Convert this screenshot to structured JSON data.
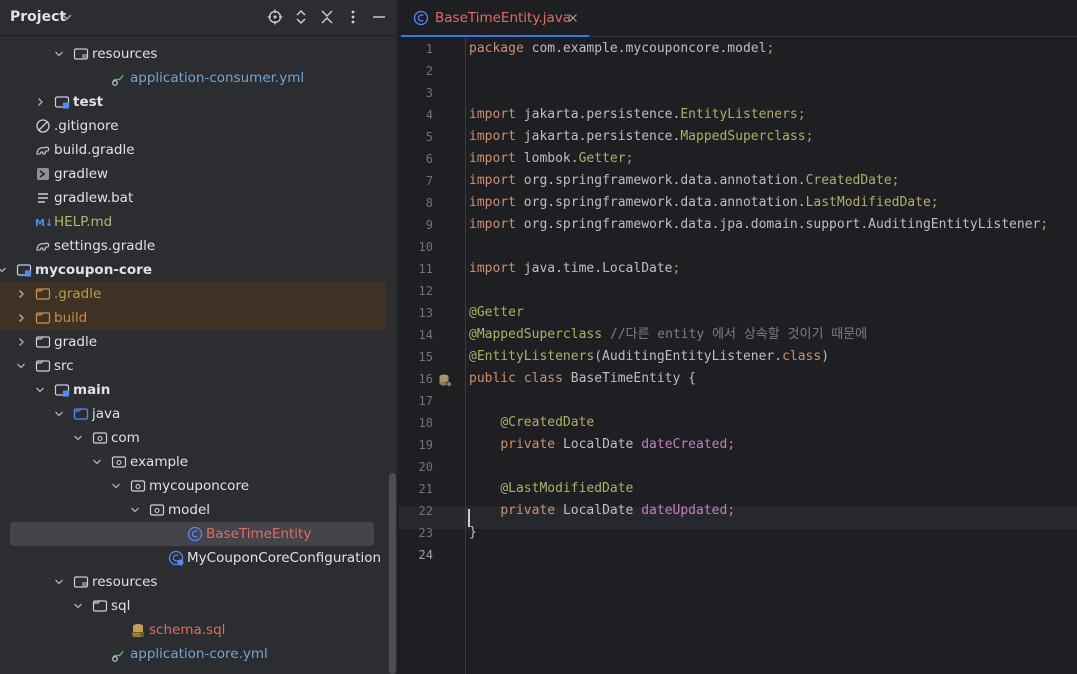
{
  "project_panel": {
    "title": "Project",
    "tree": [
      {
        "label": "resources",
        "depth": 5,
        "icon": "resources-folder-icon",
        "chevron": "down"
      },
      {
        "label": "application-consumer.yml",
        "depth": 7,
        "icon": "yaml-file-icon",
        "style": "yaml"
      },
      {
        "label": "test",
        "depth": 4,
        "icon": "test-folder-icon",
        "chevron": "right",
        "bold": true
      },
      {
        "label": ".gitignore",
        "depth": 3,
        "icon": "gitignore-icon"
      },
      {
        "label": "build.gradle",
        "depth": 3,
        "icon": "gradle-icon"
      },
      {
        "label": "gradlew",
        "depth": 3,
        "icon": "terminal-file-icon"
      },
      {
        "label": "gradlew.bat",
        "depth": 3,
        "icon": "text-file-icon"
      },
      {
        "label": "HELP.md",
        "depth": 3,
        "icon": "markdown-icon",
        "style": "md"
      },
      {
        "label": "settings.gradle",
        "depth": 3,
        "icon": "gradle-icon"
      },
      {
        "label": "mycoupon-core",
        "depth": 2,
        "icon": "module-folder-icon",
        "chevron": "down",
        "bold": true
      },
      {
        "label": ".gradle",
        "depth": 3,
        "icon": "excluded-folder-icon",
        "chevron": "right",
        "style": "gradle-ex",
        "excluded": true
      },
      {
        "label": "build",
        "depth": 3,
        "icon": "excluded-folder-icon",
        "chevron": "right",
        "style": "build-ex",
        "excluded": true
      },
      {
        "label": "gradle",
        "depth": 3,
        "icon": "folder-icon",
        "chevron": "right"
      },
      {
        "label": "src",
        "depth": 3,
        "icon": "folder-icon",
        "chevron": "down"
      },
      {
        "label": "main",
        "depth": 4,
        "icon": "module-folder-icon",
        "chevron": "down",
        "bold": true
      },
      {
        "label": "java",
        "depth": 5,
        "icon": "source-folder-icon",
        "chevron": "down"
      },
      {
        "label": "com",
        "depth": 6,
        "icon": "package-icon",
        "chevron": "down"
      },
      {
        "label": "example",
        "depth": 7,
        "icon": "package-icon",
        "chevron": "down"
      },
      {
        "label": "mycouponcore",
        "depth": 8,
        "icon": "package-icon",
        "chevron": "down"
      },
      {
        "label": "model",
        "depth": 9,
        "icon": "package-icon",
        "chevron": "down"
      },
      {
        "label": "BaseTimeEntity",
        "depth": 11,
        "icon": "class-icon",
        "style": "err",
        "selected": true
      },
      {
        "label": "MyCouponCoreConfiguration",
        "depth": 10,
        "icon": "config-class-icon"
      },
      {
        "label": "resources",
        "depth": 5,
        "icon": "resources-folder-icon",
        "chevron": "down"
      },
      {
        "label": "sql",
        "depth": 6,
        "icon": "folder-icon",
        "chevron": "down"
      },
      {
        "label": "schema.sql",
        "depth": 8,
        "icon": "sql-file-icon",
        "style": "sql"
      },
      {
        "label": "application-core.yml",
        "depth": 7,
        "icon": "yaml-file-icon",
        "style": "yaml"
      }
    ]
  },
  "editor": {
    "tab_label": "BaseTimeEntity.java",
    "current_line": 24,
    "lines": [
      [
        [
          "k",
          "package "
        ],
        [
          "t",
          "com.example.mycouponcore.model"
        ],
        [
          "k",
          ";"
        ]
      ],
      [],
      [],
      [
        [
          "k",
          "import "
        ],
        [
          "t",
          "jakarta.persistence."
        ],
        [
          "a",
          "EntityListeners"
        ],
        [
          "k",
          ";"
        ]
      ],
      [
        [
          "k",
          "import "
        ],
        [
          "t",
          "jakarta.persistence."
        ],
        [
          "a",
          "MappedSuperclass"
        ],
        [
          "k",
          ";"
        ]
      ],
      [
        [
          "k",
          "import "
        ],
        [
          "t",
          "lombok."
        ],
        [
          "a",
          "Getter"
        ],
        [
          "k",
          ";"
        ]
      ],
      [
        [
          "k",
          "import "
        ],
        [
          "t",
          "org.springframework.data.annotation."
        ],
        [
          "a",
          "CreatedDate"
        ],
        [
          "k",
          ";"
        ]
      ],
      [
        [
          "k",
          "import "
        ],
        [
          "t",
          "org.springframework.data.annotation."
        ],
        [
          "a",
          "LastModifiedDate"
        ],
        [
          "k",
          ";"
        ]
      ],
      [
        [
          "k",
          "import "
        ],
        [
          "t",
          "org.springframework.data.jpa.domain.support.AuditingEntityListener"
        ],
        [
          "k",
          ";"
        ]
      ],
      [],
      [
        [
          "k",
          "import "
        ],
        [
          "t",
          "java.time.LocalDate"
        ],
        [
          "k",
          ";"
        ]
      ],
      [],
      [
        [
          "a",
          "@Getter"
        ]
      ],
      [
        [
          "a",
          "@MappedSuperclass "
        ],
        [
          "cm",
          "//다른 entity 에서 상속할 것이기 때문에"
        ]
      ],
      [
        [
          "a",
          "@EntityListeners"
        ],
        [
          "t",
          "(AuditingEntityListener."
        ],
        [
          "k",
          "class"
        ],
        [
          "t",
          ")"
        ]
      ],
      [
        [
          "k",
          "public class "
        ],
        [
          "t",
          "BaseTimeEntity {"
        ]
      ],
      [],
      [
        [
          "t",
          "    "
        ],
        [
          "a",
          "@CreatedDate"
        ]
      ],
      [
        [
          "t",
          "    "
        ],
        [
          "k",
          "private "
        ],
        [
          "t",
          "LocalDate "
        ],
        [
          "f",
          "dateCreated"
        ],
        [
          "k",
          ";"
        ]
      ],
      [],
      [
        [
          "t",
          "    "
        ],
        [
          "a",
          "@LastModifiedDate"
        ]
      ],
      [
        [
          "t",
          "    "
        ],
        [
          "k",
          "private "
        ],
        [
          "t",
          "LocalDate "
        ],
        [
          "f",
          "dateUpdated"
        ],
        [
          "k",
          ";"
        ]
      ],
      [
        [
          "t",
          "}"
        ]
      ],
      []
    ]
  }
}
